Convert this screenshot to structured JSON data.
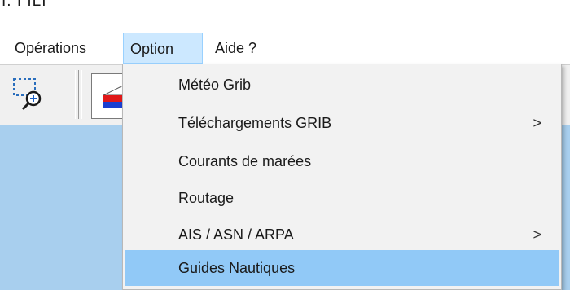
{
  "title": {
    "fragment": "I. I ILI"
  },
  "menubar": {
    "items": [
      {
        "label": "Opérations"
      },
      {
        "label": "Option"
      },
      {
        "label": "Aide ?"
      }
    ]
  },
  "toolbar": {
    "tools": [
      {
        "icon": "zoom-selection-icon"
      },
      {
        "icon": "layer-icon"
      }
    ]
  },
  "dropdown": {
    "items": [
      {
        "label": "Météo Grib",
        "has_submenu": false
      },
      {
        "label": "Téléchargements GRIB",
        "has_submenu": true,
        "arrow": ">"
      },
      {
        "label": "Courants de marées",
        "has_submenu": false
      },
      {
        "label": "Routage",
        "has_submenu": false
      },
      {
        "label": "AIS / ASN / ARPA",
        "has_submenu": true,
        "arrow": ">"
      },
      {
        "label": "Guides Nautiques",
        "has_submenu": false,
        "highlighted": true
      }
    ]
  },
  "colors": {
    "menu_active_bg": "#cce8ff",
    "menu_highlight_bg": "#91c9f7",
    "dropdown_bg": "#f2f2f2",
    "workarea_bg": "#a8cfee"
  }
}
